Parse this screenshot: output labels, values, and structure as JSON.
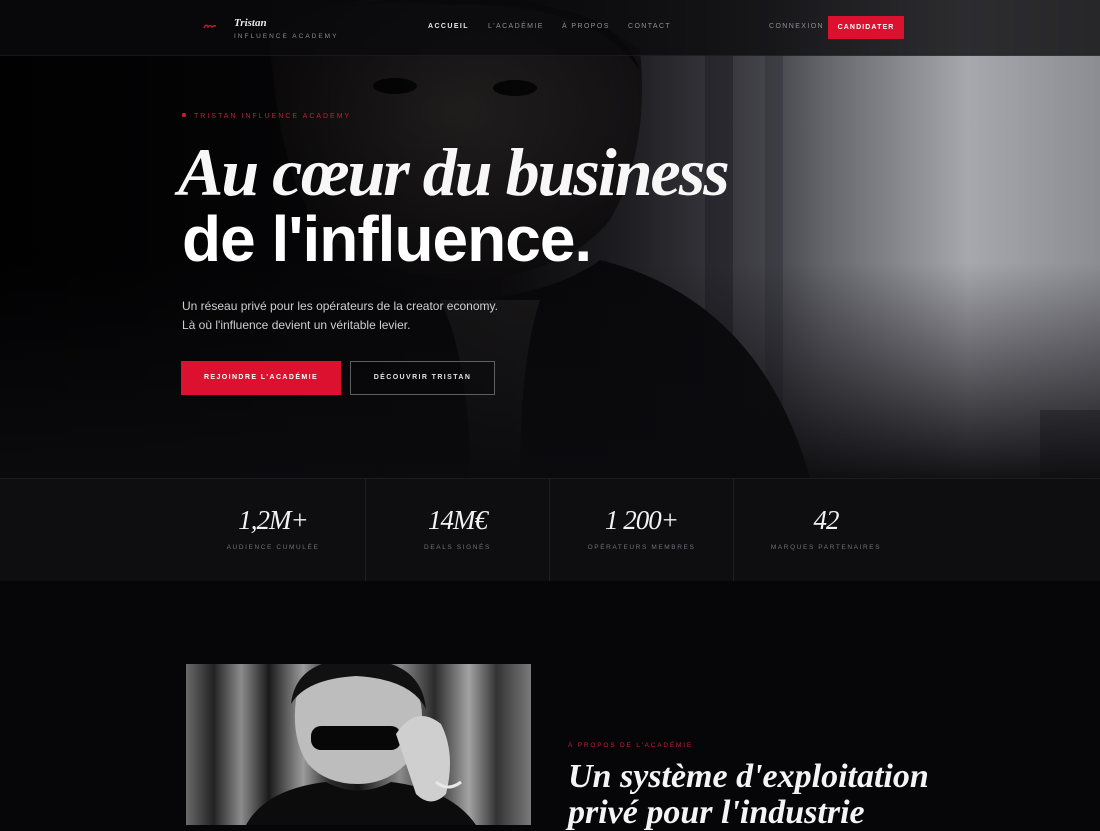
{
  "brand": {
    "name": "Tristan",
    "subtitle": "INFLUENCE ACADEMY",
    "accent_color": "#dc1130"
  },
  "nav": {
    "links": [
      {
        "label": "ACCUEIL",
        "active": true
      },
      {
        "label": "L'ACADÉMIE",
        "active": false
      },
      {
        "label": "À PROPOS",
        "active": false
      },
      {
        "label": "CONTACT",
        "active": false
      }
    ],
    "login": "CONNEXION",
    "cta": "CANDIDATER"
  },
  "hero": {
    "kicker": "TRISTAN INFLUENCE ACADEMY",
    "headline_line1": "Au cœur du business",
    "headline_line2": "de l'influence.",
    "lead_line1": "Un réseau privé pour les opérateurs de la creator economy.",
    "lead_line2": "Là où l'influence devient un véritable levier.",
    "primary_button": "REJOINDRE L'ACADÉMIE",
    "secondary_button": "DÉCOUVRIR TRISTAN"
  },
  "stats": [
    {
      "value": "1,2M+",
      "label": "AUDIENCE CUMULÉE"
    },
    {
      "value": "14M€",
      "label": "DEALS SIGNÉS"
    },
    {
      "value": "1 200+",
      "label": "OPÉRATEURS MEMBRES"
    },
    {
      "value": "42",
      "label": "MARQUES PARTENAIRES"
    }
  ],
  "about": {
    "kicker": "À PROPOS DE L'ACADÉMIE",
    "title_line1": "Un système d'exploitation",
    "title_line2": "privé pour l'industrie"
  }
}
